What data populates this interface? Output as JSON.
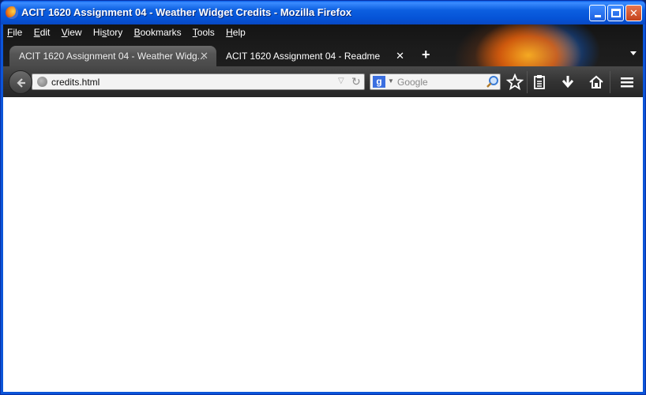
{
  "window": {
    "title": "ACIT 1620 Assignment 04 - Weather Widget Credits - Mozilla Firefox"
  },
  "menu": [
    {
      "key": "F",
      "rest": "ile"
    },
    {
      "key": "E",
      "rest": "dit"
    },
    {
      "key": "V",
      "rest": "iew"
    },
    {
      "key": "",
      "rest": "Hi",
      "key2": "s",
      "rest2": "tory"
    },
    {
      "key": "B",
      "rest": "ookmarks"
    },
    {
      "key": "T",
      "rest": "ools"
    },
    {
      "key": "H",
      "rest": "elp"
    }
  ],
  "tabs": [
    {
      "label": "ACIT 1620 Assignment 04 - Weather Widg...",
      "active": true
    },
    {
      "label": "ACIT 1620 Assignment 04 - Readme",
      "active": false
    }
  ],
  "urlbar": {
    "value": "credits.html"
  },
  "search": {
    "engine": "g",
    "placeholder": "Google"
  },
  "icons": {
    "back": "back-arrow-icon",
    "bookmark": "star-icon",
    "reading": "clipboard-icon",
    "downloads": "download-arrow-icon",
    "home": "home-icon",
    "menu": "hamburger-menu-icon"
  },
  "colors": {
    "titlebar": "#0b55d8",
    "chrome": "#1b1b1b",
    "content": "#ffffff"
  }
}
